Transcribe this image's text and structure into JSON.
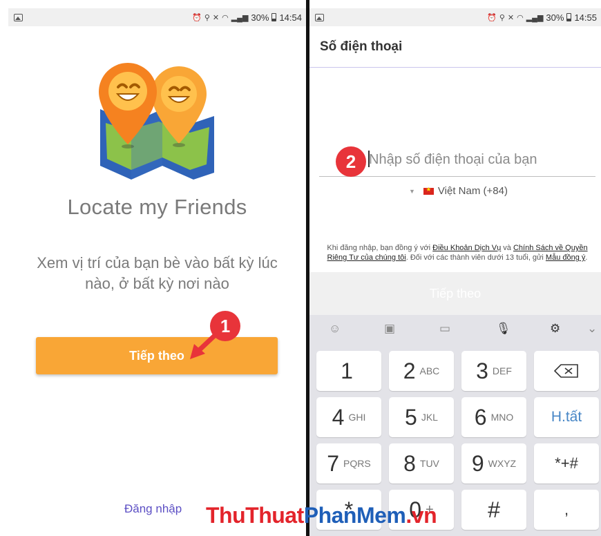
{
  "left_screen": {
    "status": {
      "battery": "30%",
      "time": "14:54"
    },
    "app_title": "Locate my Friends",
    "description": "Xem vị trí của bạn bè vào bất kỳ lúc nào, ở bất kỳ nơi nào",
    "next_button": "Tiếp theo",
    "login_link": "Đăng nhập",
    "step_badge": "1"
  },
  "right_screen": {
    "status": {
      "battery": "30%",
      "time": "14:55"
    },
    "header_title": "Số điện thoại",
    "step_badge": "2",
    "phone_input": {
      "value": "",
      "placeholder": "Nhập số điện thoại của bạn"
    },
    "country": "Việt Nam (+84)",
    "terms": {
      "p1": "Khi đăng nhập, bạn đồng ý với ",
      "link1": "Điều Khoản Dịch Vụ",
      "p2": " và ",
      "link2": "Chính Sách về Quyền Riêng Tư của chúng tôi",
      "p3": ". Đối với các thành viên dưới 13 tuổi, gửi ",
      "link3": "Mẫu đồng ý",
      "p4": "."
    },
    "next_button": "Tiếp theo",
    "keyboard": {
      "rows": [
        [
          {
            "digit": "1",
            "letters": ""
          },
          {
            "digit": "2",
            "letters": "ABC"
          },
          {
            "digit": "3",
            "letters": "DEF"
          }
        ],
        [
          {
            "digit": "4",
            "letters": "GHI"
          },
          {
            "digit": "5",
            "letters": "JKL"
          },
          {
            "digit": "6",
            "letters": "MNO"
          }
        ],
        [
          {
            "digit": "7",
            "letters": "PQRS"
          },
          {
            "digit": "8",
            "letters": "TUV"
          },
          {
            "digit": "9",
            "letters": "WXYZ"
          }
        ],
        [
          {
            "digit": "*",
            "letters": ""
          },
          {
            "digit": "0",
            "letters": "+"
          },
          {
            "digit": "#",
            "letters": ""
          }
        ]
      ],
      "done_key": "H.tất",
      "symbols_key": "*+#",
      "comma_key": ","
    }
  },
  "watermark": {
    "part1": "ThuThuat",
    "part2": "PhanMem",
    "part3": ".vn"
  },
  "colors": {
    "orange": "#f9a636",
    "badge_red": "#e8343a",
    "link_purple": "#5c4fc4",
    "done_blue": "#4786c6"
  }
}
